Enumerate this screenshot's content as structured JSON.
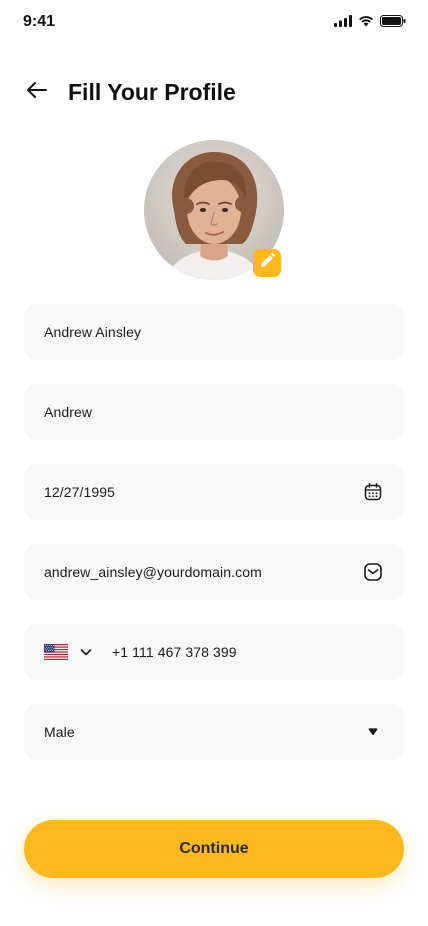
{
  "status_bar": {
    "time": "9:41"
  },
  "header": {
    "title": "Fill Your Profile",
    "back_icon": "arrow-left-icon"
  },
  "avatar": {
    "edit_icon": "pencil-icon",
    "accent_color": "#FDB81E"
  },
  "form": {
    "full_name": "Andrew Ainsley",
    "nickname": "Andrew",
    "date_of_birth": "12/27/1995",
    "date_icon": "calendar-icon",
    "email": "andrew_ainsley@yourdomain.com",
    "email_icon": "mail-icon",
    "phone_country_icon": "us-flag-icon",
    "phone_number": "+1 111 467 378 399",
    "gender": "Male",
    "gender_icon": "caret-down-icon"
  },
  "actions": {
    "continue_label": "Continue"
  },
  "colors": {
    "accent": "#FDB81E",
    "field_bg": "#F8F8F8",
    "text": "#1a1a1a"
  }
}
